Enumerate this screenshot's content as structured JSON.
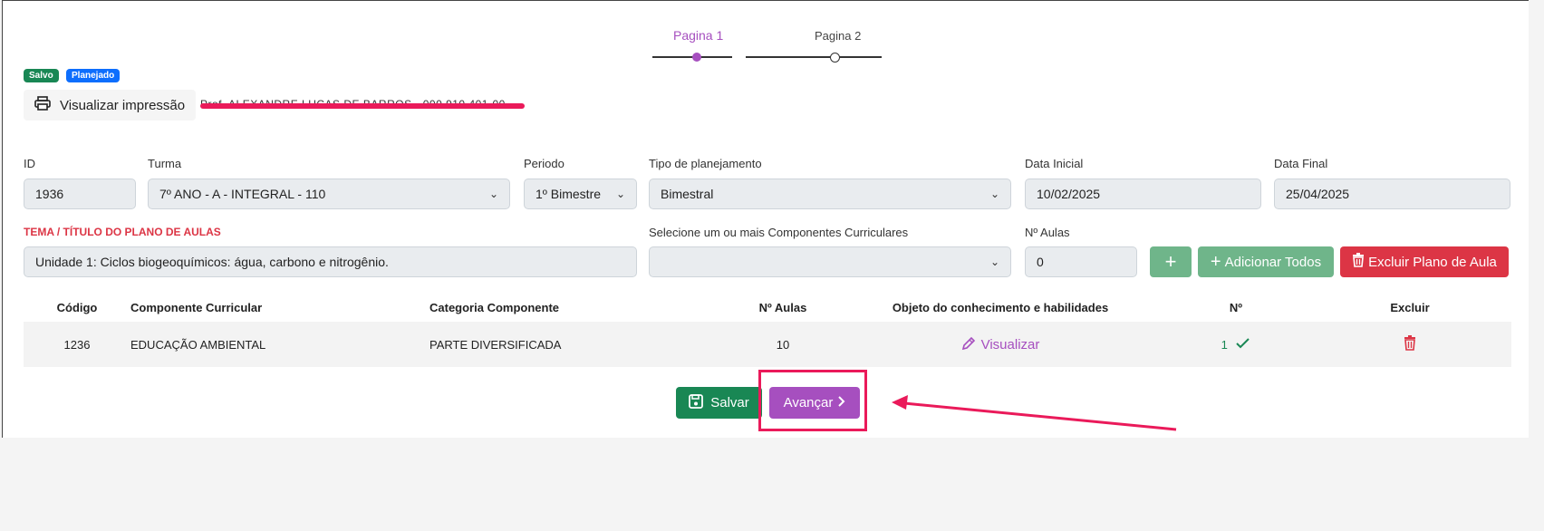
{
  "stepper": {
    "page1": "Pagina 1",
    "page2": "Pagina 2"
  },
  "badges": {
    "saved": "Salvo",
    "planned": "Planejado"
  },
  "print_button": "Visualizar impressão",
  "redacted_text": "Prof. ALEXANDRE LUCAS DE BARROS - 000.910.401-00",
  "form": {
    "id": {
      "label": "ID",
      "value": "1936"
    },
    "turma": {
      "label": "Turma",
      "value": "7º ANO - A - INTEGRAL - 110"
    },
    "periodo": {
      "label": "Periodo",
      "value": "1º Bimestre"
    },
    "tipo": {
      "label": "Tipo de planejamento",
      "value": "Bimestral"
    },
    "data_inicial": {
      "label": "Data Inicial",
      "value": "10/02/2025"
    },
    "data_final": {
      "label": "Data Final",
      "value": "25/04/2025"
    },
    "tema": {
      "label": "TEMA / TÍTULO DO PLANO DE AULAS",
      "value": "Unidade 1: Ciclos biogeoquímicos: água, carbono e nitrogênio."
    },
    "componentes": {
      "label": "Selecione um ou mais Componentes Curriculares",
      "value": ""
    },
    "n_aulas": {
      "label": "Nº Aulas",
      "value": "0"
    }
  },
  "buttons": {
    "plus": "+",
    "add_all": "Adicionar Todos",
    "delete_plan": "Excluir Plano de Aula",
    "save": "Salvar",
    "next": "Avançar"
  },
  "table": {
    "headers": [
      "Código",
      "Componente Curricular",
      "Categoria Componente",
      "Nº Aulas",
      "Objeto do conhecimento e habilidades",
      "Nº",
      "Excluir"
    ],
    "rows": [
      {
        "codigo": "1236",
        "componente": "EDUCAÇÃO AMBIENTAL",
        "categoria": "PARTE DIVERSIFICADA",
        "aulas": "10",
        "objeto": "Visualizar",
        "n": "1"
      }
    ]
  },
  "colors": {
    "purple": "#a64fbf",
    "green": "#198754",
    "light_green": "#6fb58a",
    "red": "#dc3545",
    "annotation": "#ea1a5a"
  }
}
